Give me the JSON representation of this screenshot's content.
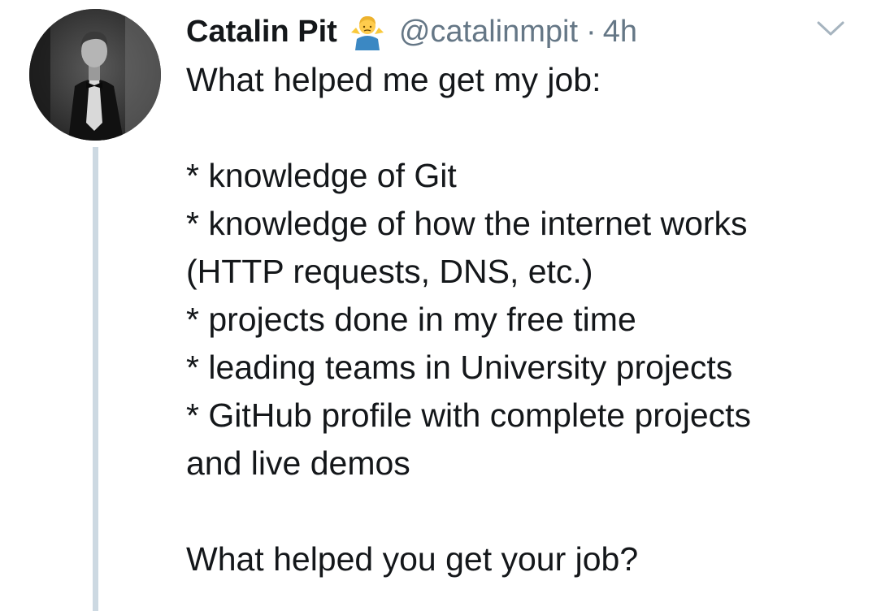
{
  "tweet": {
    "display_name": "Catalin Pit",
    "emoji_icon": "person-shrugging-emoji-icon",
    "handle": "@catalinmpit",
    "separator": "·",
    "time": "4h",
    "lines": [
      "What helped me get my job:",
      "",
      "* knowledge of Git",
      "* knowledge of how the internet works",
      "(HTTP requests, DNS, etc.)",
      "* projects done in my free time",
      "* leading teams in University projects",
      "* GitHub profile with complete projects",
      "and live demos",
      "",
      "What helped you get your job?"
    ]
  },
  "icons": {
    "more_menu": "chevron-down-icon",
    "avatar": "avatar"
  },
  "colors": {
    "text_primary": "#14171a",
    "text_secondary": "#657786",
    "thread_line": "#cdd9e2",
    "caret": "#a6b4bf"
  }
}
